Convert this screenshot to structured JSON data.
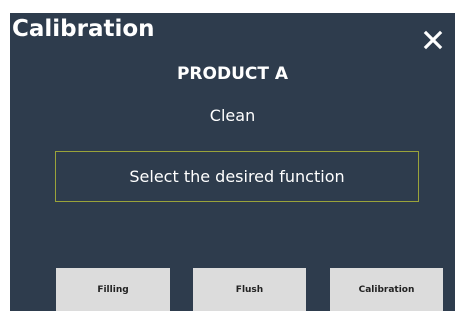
{
  "header": {
    "title": "Calibration",
    "close_icon": "close-icon"
  },
  "product": {
    "name": "PRODUCT A",
    "mode": "Clean"
  },
  "prompt": {
    "text": "Select the desired function"
  },
  "buttons": [
    {
      "label": "Filling"
    },
    {
      "label": "Flush"
    },
    {
      "label": "Calibration"
    }
  ],
  "colors": {
    "background": "#2e3c4d",
    "text": "#ffffff",
    "prompt_border": "#9aa33a",
    "button_bg": "#dcdcdc",
    "button_text": "#222222"
  }
}
